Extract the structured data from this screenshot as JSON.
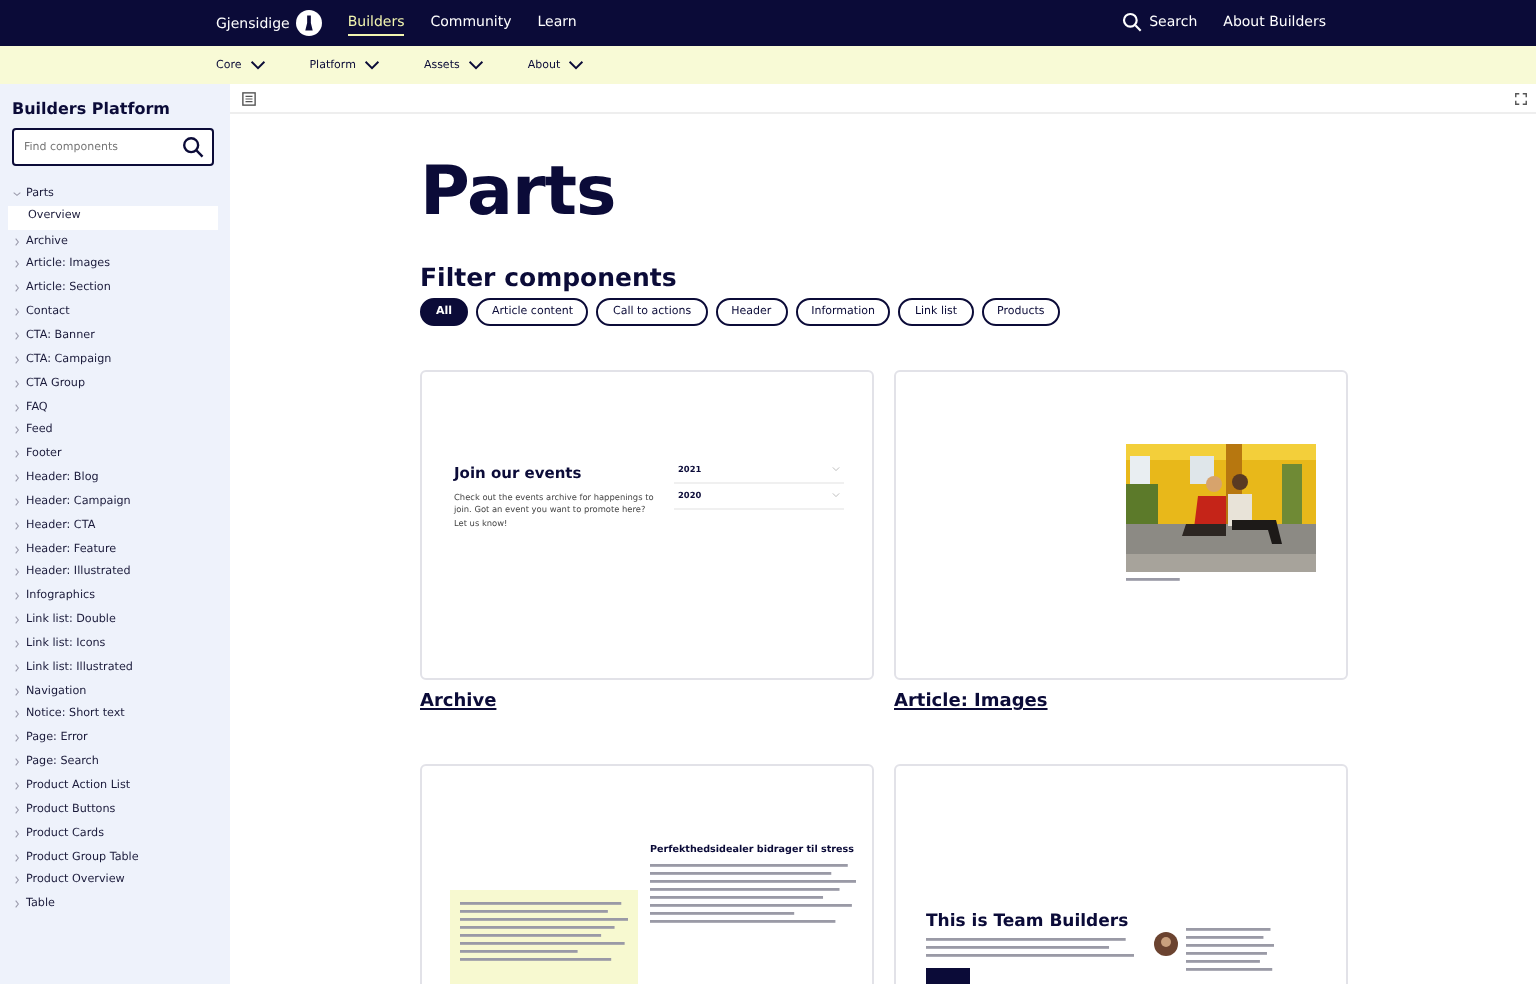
{
  "top_nav": {
    "logo": "Gjensidige",
    "links": [
      {
        "label": "Builders",
        "selected": true
      },
      {
        "label": "Community",
        "selected": false
      },
      {
        "label": "Learn",
        "selected": false
      }
    ],
    "search": "Search",
    "about": "About Builders"
  },
  "sub_nav": [
    "Core",
    "Platform",
    "Assets",
    "About"
  ],
  "sidebar": {
    "title": "Builders Platform",
    "search": {
      "placeholder": "Find components"
    },
    "items": [
      {
        "label": "Parts",
        "expanded": true,
        "children": [
          {
            "label": "Overview",
            "selected": true
          }
        ]
      },
      {
        "label": "Archive",
        "expanded": false
      },
      {
        "label": "Article: Images",
        "expanded": false
      },
      {
        "label": "Article: Section",
        "expanded": false
      },
      {
        "label": "Contact",
        "expanded": false
      },
      {
        "label": "CTA: Banner",
        "expanded": false
      },
      {
        "label": "CTA: Campaign",
        "expanded": false
      },
      {
        "label": "CTA Group",
        "expanded": false
      },
      {
        "label": "FAQ",
        "expanded": false
      },
      {
        "label": "Feed",
        "expanded": false
      },
      {
        "label": "Footer",
        "expanded": false
      },
      {
        "label": "Header: Blog",
        "expanded": false
      },
      {
        "label": "Header: Campaign",
        "expanded": false
      },
      {
        "label": "Header: CTA",
        "expanded": false
      },
      {
        "label": "Header: Feature",
        "expanded": false
      },
      {
        "label": "Header: Illustrated",
        "expanded": false
      },
      {
        "label": "Infographics",
        "expanded": false
      },
      {
        "label": "Link list: Double",
        "expanded": false
      },
      {
        "label": "Link list: Icons",
        "expanded": false
      },
      {
        "label": "Link list: Illustrated",
        "expanded": false
      },
      {
        "label": "Navigation",
        "expanded": false
      },
      {
        "label": "Notice: Short text",
        "expanded": false
      },
      {
        "label": "Page: Error",
        "expanded": false
      },
      {
        "label": "Page: Search",
        "expanded": false
      },
      {
        "label": "Product Action List",
        "expanded": false
      },
      {
        "label": "Product Buttons",
        "expanded": false
      },
      {
        "label": "Product Cards",
        "expanded": false
      },
      {
        "label": "Product Group Table",
        "expanded": false
      },
      {
        "label": "Product Overview",
        "expanded": false
      },
      {
        "label": "Table",
        "expanded": false
      }
    ]
  },
  "page": {
    "title": "Parts",
    "filter_title": "Filter components",
    "filters": [
      {
        "label": "All",
        "selected": true
      },
      {
        "label": "Article content",
        "selected": false
      },
      {
        "label": "Call to actions",
        "selected": false
      },
      {
        "label": "Header",
        "selected": false
      },
      {
        "label": "Information",
        "selected": false
      },
      {
        "label": "Link list",
        "selected": false
      },
      {
        "label": "Products",
        "selected": false
      }
    ],
    "cards": [
      {
        "kind": "events",
        "name": "Archive",
        "heading": "Join our events",
        "text": "Check out the events archive for happenings to join. Got an event you want to promote here? Let us know!",
        "years": [
          "2021",
          "2020"
        ]
      },
      {
        "name": "Article: Images"
      },
      {
        "kind": "article",
        "heading": "Perfekthedsidealer bidrager til stress"
      },
      {
        "kind": "team",
        "heading": "This is Team Builders"
      }
    ]
  }
}
